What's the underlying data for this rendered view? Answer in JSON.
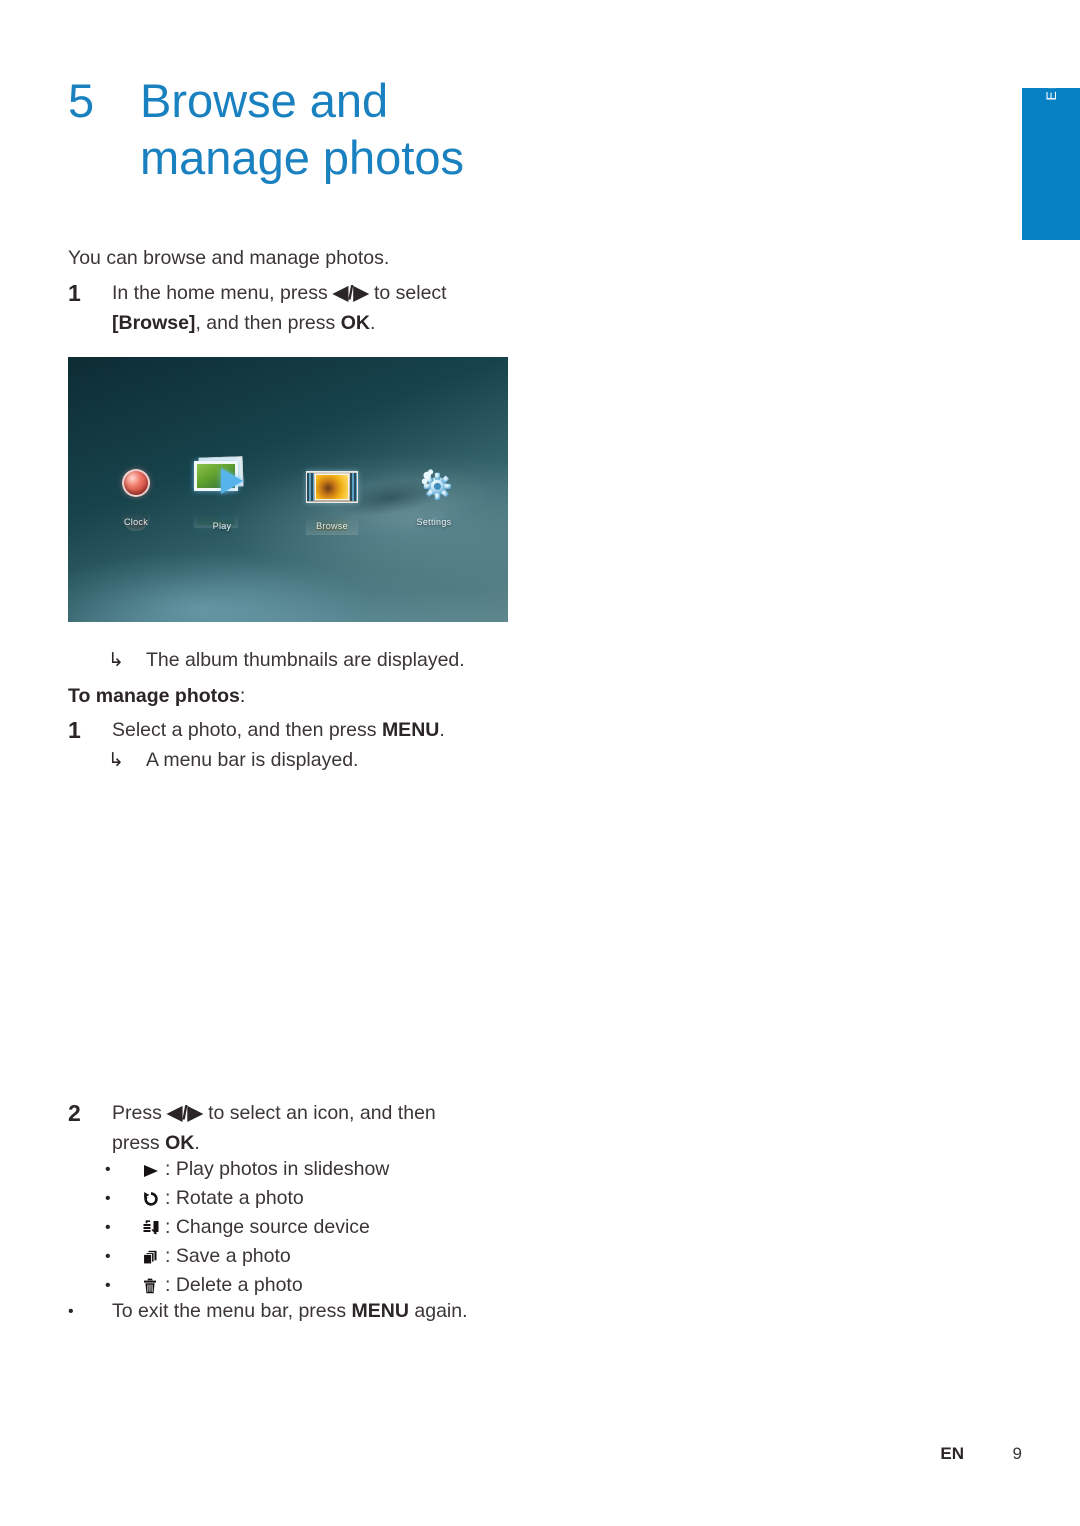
{
  "page": {
    "language_tab": "English",
    "footer": {
      "lang_code": "EN",
      "page_number": "9"
    },
    "accent_color": "#1a81c0",
    "tab_color": "#0780c4"
  },
  "heading": {
    "number": "5",
    "title_line1": "Browse and",
    "title_line2": "manage photos"
  },
  "intro": "You can browse and manage photos.",
  "step1": {
    "number": "1",
    "text_a": "In the home menu, press ",
    "nav_glyph": "◀/▶",
    "text_b": " to select ",
    "bold_a": "[Browse]",
    "text_c": ", and then press ",
    "bold_b": "OK",
    "text_d": "."
  },
  "result1": {
    "arrow": "↳",
    "text": "The album thumbnails are displayed."
  },
  "subhead": {
    "text": "To manage photos",
    "colon": ":"
  },
  "step1b": {
    "number": "1",
    "text_a": "Select a photo, and then press ",
    "bold_a": "MENU",
    "text_b": "."
  },
  "result2": {
    "arrow": "↳",
    "text": "A menu bar is displayed."
  },
  "step2": {
    "number": "2",
    "text_a": "Press ",
    "nav_glyph": "◀/▶",
    "text_b": " to select an icon, and then",
    "line2_a": "press ",
    "line2_bold": "OK",
    "line2_b": "."
  },
  "icon_bullets": [
    {
      "bullet": "•",
      "icon": "play-triangle-icon",
      "label": ": Play photos in slideshow"
    },
    {
      "bullet": "•",
      "icon": "rotate-icon",
      "label": ": Rotate a photo"
    },
    {
      "bullet": "•",
      "icon": "change-source-device-icon",
      "label": ": Change source device"
    },
    {
      "bullet": "•",
      "icon": "save-photo-icon",
      "label": ": Save a photo"
    },
    {
      "bullet": "•",
      "icon": "trash-icon",
      "label": ": Delete a photo"
    }
  ],
  "exit_bullet": {
    "bullet": "•",
    "text_a": "To exit the menu bar, press ",
    "bold_a": "MENU",
    "text_b": " again."
  },
  "home_screen": {
    "items": [
      {
        "label": "Clock",
        "icon": "clock-sphere-icon"
      },
      {
        "label": "Play",
        "icon": "play-photos-icon"
      },
      {
        "label": "Browse",
        "icon": "browse-filmstrip-icon"
      },
      {
        "label": "Settings",
        "icon": "gear-icon"
      }
    ]
  }
}
